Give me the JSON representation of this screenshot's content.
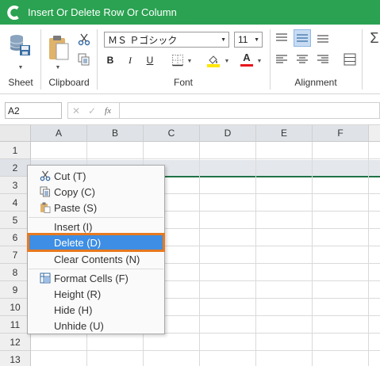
{
  "window": {
    "title": "Insert Or Delete Row Or Column"
  },
  "ribbon": {
    "groups": [
      "Sheet",
      "Clipboard",
      "Font",
      "Alignment"
    ],
    "font_name": "ＭＳ Ｐゴシック",
    "font_size": "11",
    "bold_label": "B",
    "italic_label": "I",
    "underline_label": "U",
    "font_color_label": "A",
    "sum_label": "Σ"
  },
  "formula_bar": {
    "cell_ref": "A2",
    "fx_label": "fx"
  },
  "grid": {
    "columns": [
      "A",
      "B",
      "C",
      "D",
      "E",
      "F"
    ],
    "rows": [
      "1",
      "2",
      "3",
      "4",
      "5",
      "6",
      "7",
      "8",
      "9",
      "10",
      "11",
      "12",
      "13"
    ],
    "selected_row": "2"
  },
  "context_menu": {
    "items": [
      {
        "label": "Cut (T)",
        "icon": "scissors-icon"
      },
      {
        "label": "Copy (C)",
        "icon": "copy-icon"
      },
      {
        "label": "Paste (S)",
        "icon": "paste-icon"
      },
      {
        "label": "Insert (I)",
        "icon": ""
      },
      {
        "label": "Delete (D)",
        "icon": ""
      },
      {
        "label": "Clear Contents (N)",
        "icon": ""
      },
      {
        "label": "Format Cells (F)",
        "icon": "format-cells-icon"
      },
      {
        "label": "Height (R)",
        "icon": ""
      },
      {
        "label": "Hide (H)",
        "icon": ""
      },
      {
        "label": "Unhide (U)",
        "icon": ""
      }
    ],
    "highlighted": "Delete (D)"
  },
  "colors": {
    "titlebar": "#2aa251",
    "menu_highlight": "#3d8ee4",
    "highlight_outline": "#e8791e",
    "selection_border": "#217346"
  }
}
